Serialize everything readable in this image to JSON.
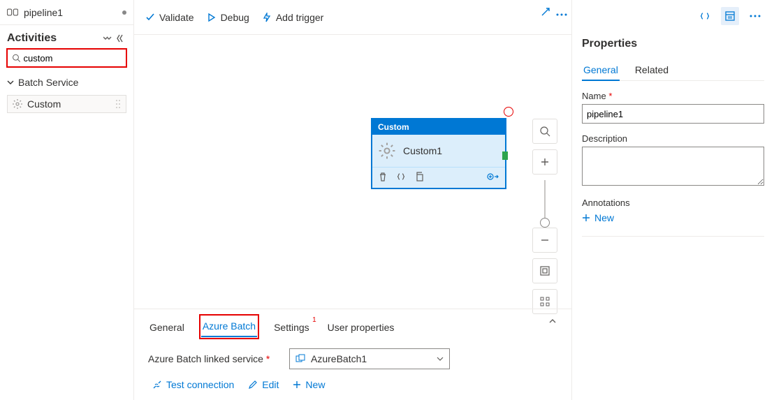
{
  "tab": {
    "title": "pipeline1"
  },
  "sidebar": {
    "heading": "Activities",
    "search_value": "custom",
    "group": "Batch Service",
    "items": [
      {
        "label": "Custom"
      }
    ]
  },
  "toolbar": {
    "validate": "Validate",
    "debug": "Debug",
    "add_trigger": "Add trigger"
  },
  "node": {
    "type": "Custom",
    "name": "Custom1"
  },
  "bottom": {
    "tabs": {
      "general": "General",
      "azure_batch": "Azure Batch",
      "settings": "Settings",
      "settings_badge": "1",
      "user_props": "User properties"
    },
    "linked_label": "Azure Batch linked service",
    "linked_value": "AzureBatch1",
    "actions": {
      "test": "Test connection",
      "edit": "Edit",
      "new": "New"
    }
  },
  "props": {
    "heading": "Properties",
    "tabs": {
      "general": "General",
      "related": "Related"
    },
    "name_label": "Name",
    "name_value": "pipeline1",
    "desc_label": "Description",
    "ann_label": "Annotations",
    "new": "New"
  }
}
